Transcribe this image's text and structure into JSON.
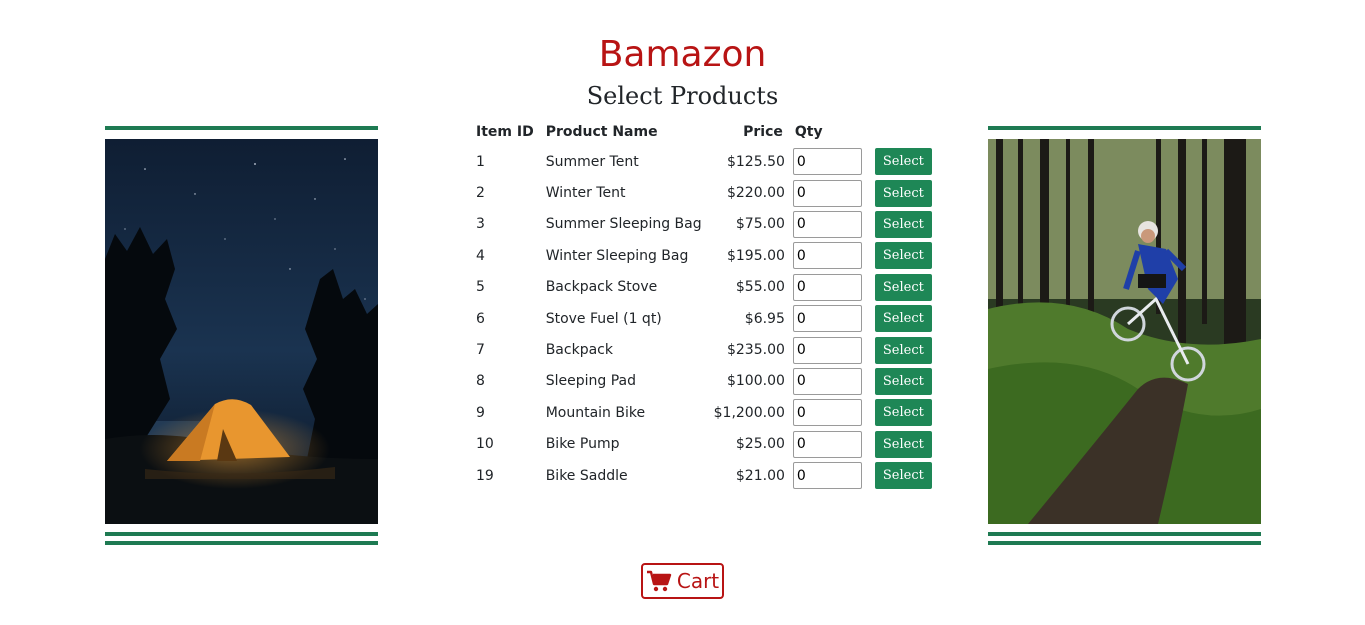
{
  "header": {
    "title": "Bamazon",
    "subtitle": "Select Products"
  },
  "colors": {
    "title": "#b81414",
    "accent_green": "#1e8756",
    "rule_green": "#1e7a52"
  },
  "images": {
    "left": "camping-tent-night-photo",
    "right": "mountain-biker-forest-photo"
  },
  "table": {
    "headers": {
      "id": "Item ID",
      "name": "Product Name",
      "price": "Price",
      "qty": "Qty"
    },
    "select_label": "Select",
    "rows": [
      {
        "id": "1",
        "name": "Summer Tent",
        "price": "$125.50",
        "qty": "0"
      },
      {
        "id": "2",
        "name": "Winter Tent",
        "price": "$220.00",
        "qty": "0"
      },
      {
        "id": "3",
        "name": "Summer Sleeping Bag",
        "price": "$75.00",
        "qty": "0"
      },
      {
        "id": "4",
        "name": "Winter Sleeping Bag",
        "price": "$195.00",
        "qty": "0"
      },
      {
        "id": "5",
        "name": "Backpack Stove",
        "price": "$55.00",
        "qty": "0"
      },
      {
        "id": "6",
        "name": "Stove Fuel (1 qt)",
        "price": "$6.95",
        "qty": "0"
      },
      {
        "id": "7",
        "name": "Backpack",
        "price": "$235.00",
        "qty": "0"
      },
      {
        "id": "8",
        "name": "Sleeping Pad",
        "price": "$100.00",
        "qty": "0"
      },
      {
        "id": "9",
        "name": "Mountain Bike",
        "price": "$1,200.00",
        "qty": "0"
      },
      {
        "id": "10",
        "name": "Bike Pump",
        "price": "$25.00",
        "qty": "0"
      },
      {
        "id": "19",
        "name": "Bike Saddle",
        "price": "$21.00",
        "qty": "0"
      }
    ]
  },
  "cart": {
    "label": "Cart",
    "icon": "shopping-cart-icon"
  }
}
